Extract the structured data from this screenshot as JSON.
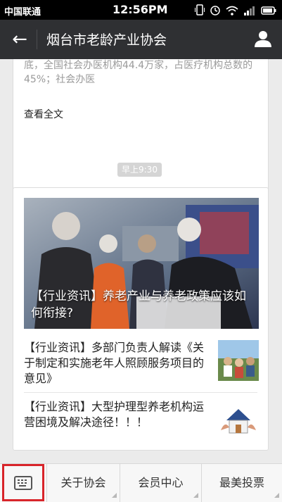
{
  "status_bar": {
    "carrier": "中国联通",
    "time": "12:56PM",
    "icons": [
      "vibrate-icon",
      "alarm-icon",
      "wifi-icon",
      "signal-icon",
      "battery-icon"
    ]
  },
  "nav": {
    "back_icon": "←",
    "title": "烟台市老龄产业协会",
    "user_icon": "user-icon"
  },
  "messages": {
    "article_excerpt": "底，全国社会办医机构44.4万家，占医疗机构总数的45%；社会办医",
    "read_full": "查看全文",
    "timestamp": "早上9:30",
    "cover_caption": "【行业资讯】养老产业与养老政策应该如何衔接?",
    "items": [
      {
        "title": "【行业资讯】多部门负责人解读《关于制定和实施老年人照顾服务项目的意见》"
      },
      {
        "title": "【行业资讯】大型护理型养老机构运营困境及解决途径！！！"
      }
    ]
  },
  "bottom_menu": {
    "keyboard_icon": "keyboard-icon",
    "tabs": [
      {
        "label": "关于协会"
      },
      {
        "label": "会员中心"
      },
      {
        "label": "最美投票"
      }
    ]
  },
  "colors": {
    "nav_bg": "#2f3033",
    "page_bg": "#ebebeb",
    "highlight": "#d8242a"
  }
}
